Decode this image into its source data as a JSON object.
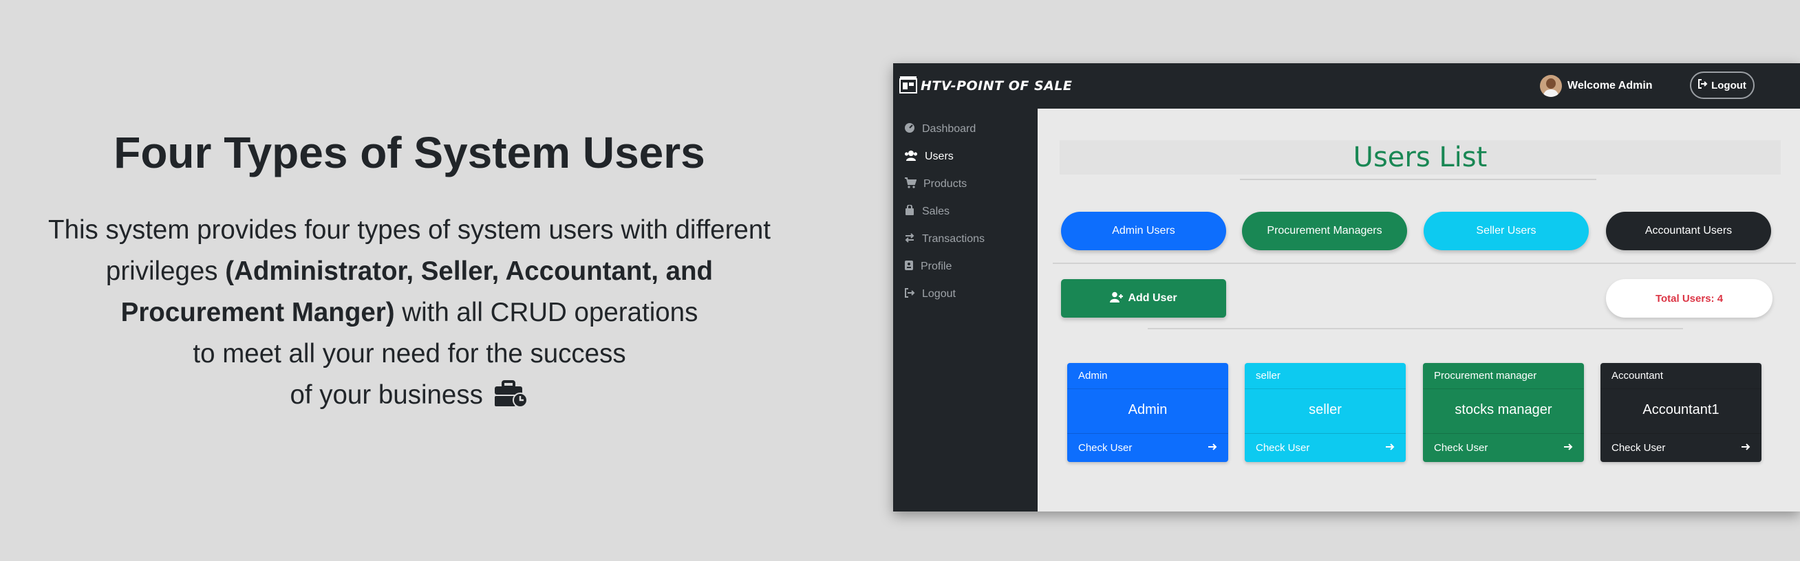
{
  "promo": {
    "title": "Four Types of System Users",
    "line1": "This system provides four types of system users with different",
    "line2_pre": "privileges ",
    "line2_bold": "(Administrator, Seller, Accountant, and",
    "line3_bold": "Procurement Manger)",
    "line3_post": " with all CRUD operations",
    "line4": "to meet all your need for the success",
    "line5": "of your business",
    "icon": "business-time-icon"
  },
  "app": {
    "brand": "HTV-POINT OF SALE",
    "welcome": "Welcome Admin",
    "logout": "Logout",
    "sidebar": {
      "items": [
        {
          "label": "Dashboard",
          "icon": "dashboard-icon"
        },
        {
          "label": "Users",
          "icon": "users-icon",
          "active": true
        },
        {
          "label": "Products",
          "icon": "cart-icon"
        },
        {
          "label": "Sales",
          "icon": "bag-icon"
        },
        {
          "label": "Transactions",
          "icon": "exchange-icon"
        },
        {
          "label": "Profile",
          "icon": "id-card-icon"
        },
        {
          "label": "Logout",
          "icon": "logout-icon"
        }
      ]
    },
    "page_title": "Users List",
    "filters": {
      "admin": "Admin Users",
      "procurement": "Procurement Managers",
      "seller": "Seller Users",
      "accountant": "Accountant Users"
    },
    "add_user": "Add User",
    "total_users": "Total Users: 4",
    "cards": [
      {
        "role": "Admin",
        "name": "Admin",
        "action": "Check User",
        "color": "#0d6efd"
      },
      {
        "role": "seller",
        "name": "seller",
        "action": "Check User",
        "color": "#0dcaf0"
      },
      {
        "role": "Procurement manager",
        "name": "stocks manager",
        "action": "Check User",
        "color": "#198754"
      },
      {
        "role": "Accountant",
        "name": "Accountant1",
        "action": "Check User",
        "color": "#212529"
      }
    ],
    "colors": {
      "primary": "#0d6efd",
      "success": "#198754",
      "info": "#0dcaf0",
      "dark": "#212529",
      "danger": "#dc3545"
    }
  }
}
